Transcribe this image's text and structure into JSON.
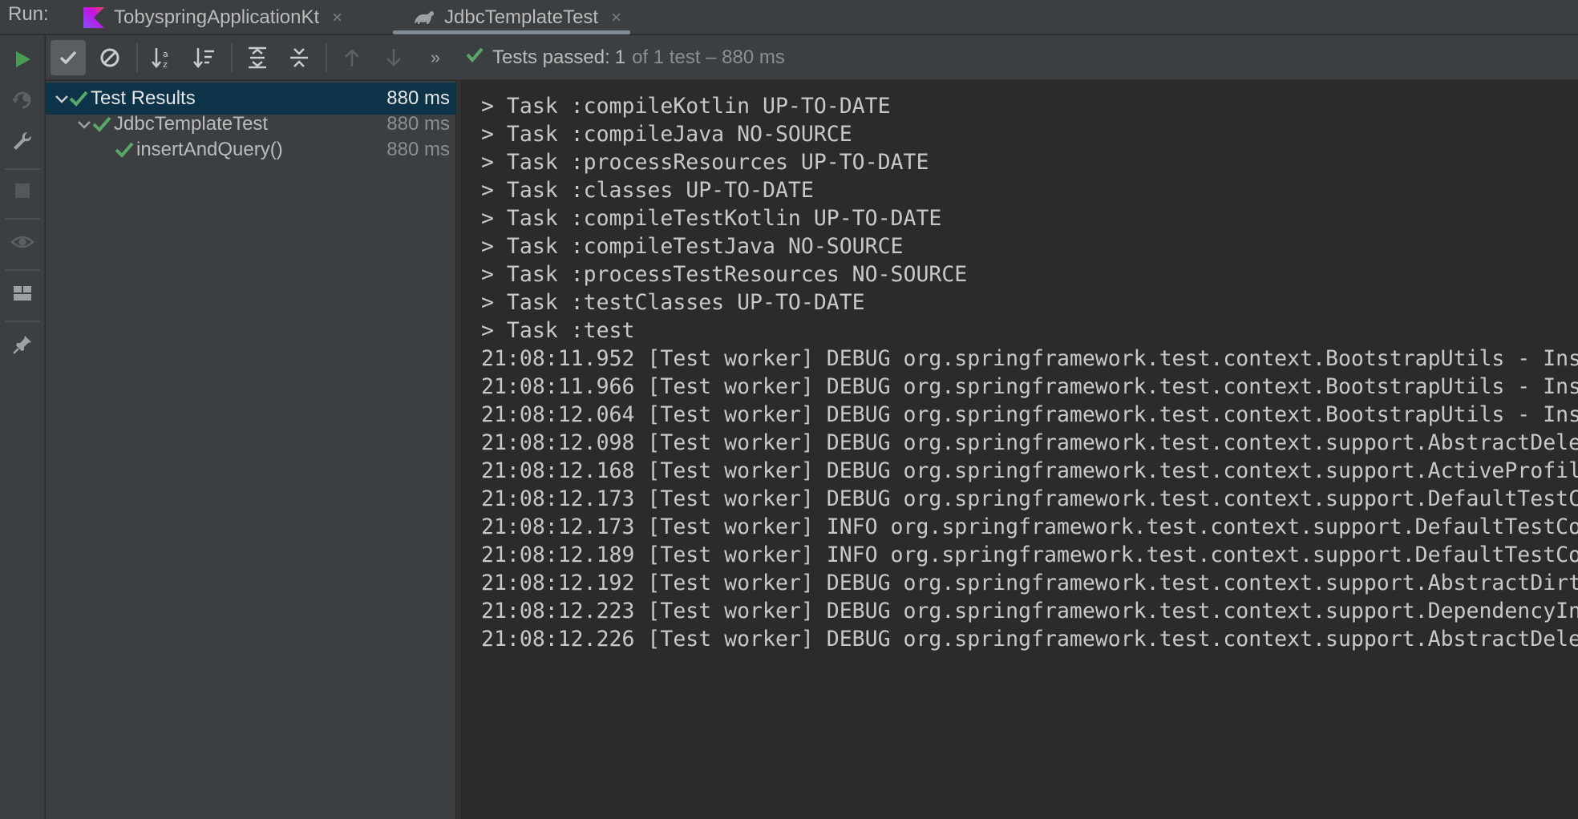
{
  "run_label": "Run:",
  "tabs": [
    {
      "label": "TobyspringApplicationKt",
      "icon": "kotlin-icon",
      "close": "×"
    },
    {
      "label": "JdbcTemplateTest",
      "icon": "gradle-icon",
      "close": "×"
    }
  ],
  "toolbar": {
    "overflow": "»",
    "status_prefix": "Tests passed:",
    "status_count": "1",
    "status_suffix": "of 1 test – 880 ms"
  },
  "tree": [
    {
      "name": "Test Results",
      "time": "880 ms"
    },
    {
      "name": "JdbcTemplateTest",
      "time": "880 ms"
    },
    {
      "name": "insertAndQuery()",
      "time": "880 ms"
    }
  ],
  "console": [
    "> Task :compileKotlin UP-TO-DATE",
    "> Task :compileJava NO-SOURCE",
    "> Task :processResources UP-TO-DATE",
    "> Task :classes UP-TO-DATE",
    "> Task :compileTestKotlin UP-TO-DATE",
    "> Task :compileTestJava NO-SOURCE",
    "> Task :processTestResources NO-SOURCE",
    "> Task :testClasses UP-TO-DATE",
    "> Task :test",
    "21:08:11.952 [Test worker] DEBUG org.springframework.test.context.BootstrapUtils - Ins",
    "21:08:11.966 [Test worker] DEBUG org.springframework.test.context.BootstrapUtils - Ins",
    "21:08:12.064 [Test worker] DEBUG org.springframework.test.context.BootstrapUtils - Ins",
    "21:08:12.098 [Test worker] DEBUG org.springframework.test.context.support.AbstractDele",
    "21:08:12.168 [Test worker] DEBUG org.springframework.test.context.support.ActiveProfil",
    "21:08:12.173 [Test worker] DEBUG org.springframework.test.context.support.DefaultTestC",
    "21:08:12.173 [Test worker] INFO org.springframework.test.context.support.DefaultTestCo",
    "21:08:12.189 [Test worker] INFO org.springframework.test.context.support.DefaultTestCo",
    "21:08:12.192 [Test worker] DEBUG org.springframework.test.context.support.AbstractDirt",
    "21:08:12.223 [Test worker] DEBUG org.springframework.test.context.support.DependencyIn",
    "21:08:12.226 [Test worker] DEBUG org.springframework.test.context.support.AbstractDele"
  ],
  "colors": {
    "check_green": "#59a869",
    "run_green": "#499c54",
    "selection": "#0d3349",
    "kotlin_purple": "#7f52ff"
  }
}
